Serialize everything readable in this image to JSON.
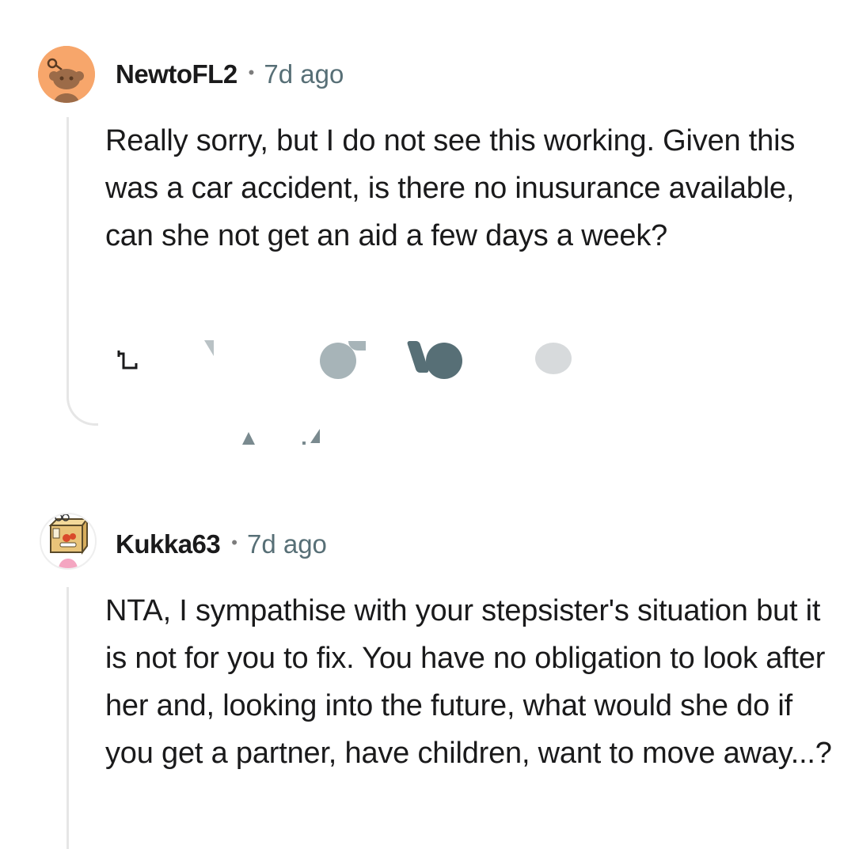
{
  "comments": [
    {
      "username": "NewtoFL2",
      "separator": "•",
      "time": "7d ago",
      "avatar_icon": "snoo-avatar-orange",
      "body": "Really sorry, but I do not see this working. Given this was a car accident, is there no inusurance available, can she not get an aid a few days a week?"
    },
    {
      "username": "Kukka63",
      "separator": "•",
      "time": "7d ago",
      "avatar_icon": "snoo-avatar-robot-box",
      "body": "NTA, I sympathise with your stepsister's situation but it is not for you to fix. You have no obligation to look after her and, looking into the future, what would she do if you get a partner, have children, want to move away...?"
    }
  ],
  "actions": {
    "reply_icon": "reply-arrow-icon"
  },
  "colors": {
    "username": "#1a1a1b",
    "meta": "#576f76",
    "thread_line": "#e6e6e6",
    "avatar_1_bg": "#f7a66b"
  }
}
